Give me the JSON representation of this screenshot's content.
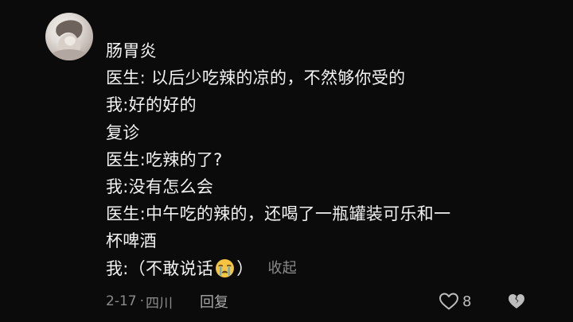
{
  "comment": {
    "lines": [
      "肠胃炎",
      "医生: 以后少吃辣的凉的，不然够你受的",
      "我:好的好的",
      "复诊",
      "医生:吃辣的了?",
      "我:没有怎么会",
      "医生:中午吃的辣的，还喝了一瓶罐装可乐和一",
      "杯啤酒"
    ],
    "last_line_before": "我:（不敢说话",
    "last_line_emoji": "crying-face-icon",
    "last_line_after": "）",
    "collapse_label": "收起"
  },
  "meta": {
    "date": "2-17",
    "dot": "·",
    "location": "四川",
    "reply_label": "回复"
  },
  "actions": {
    "like_count": "8",
    "like_icon": "heart-outline-icon",
    "dislike_icon": "broken-heart-icon"
  },
  "colors": {
    "background": "#0b0b0b",
    "text": "#f2f2f2",
    "muted": "#8c8c8c",
    "emoji_face": "#f5c542",
    "emoji_tear": "#5aa9e6"
  }
}
